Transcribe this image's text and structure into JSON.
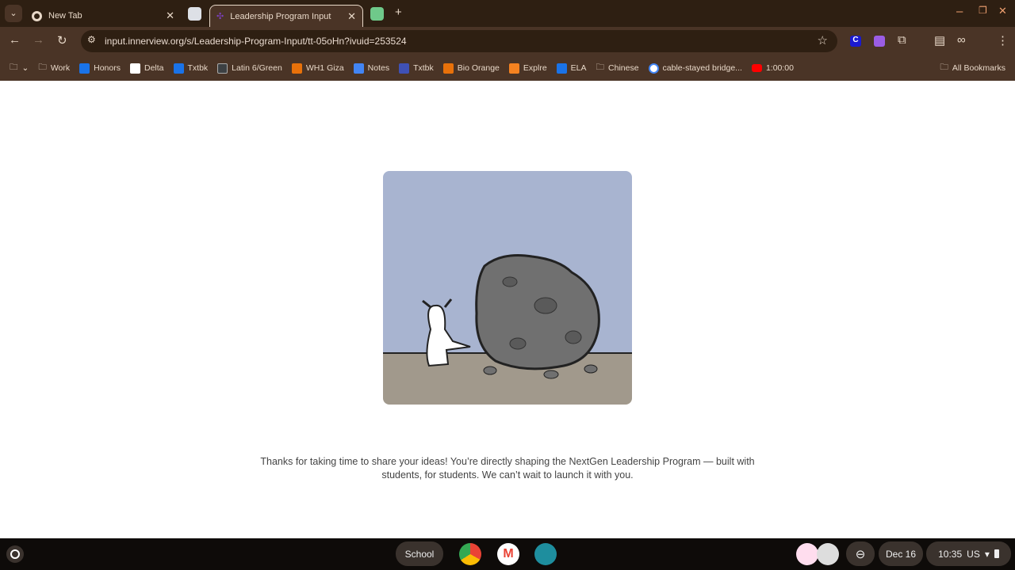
{
  "tabs": [
    {
      "label": "New Tab"
    },
    {
      "label": "Leadership Program Input",
      "active": true
    }
  ],
  "address": {
    "url": "input.innerview.org/s/Leadership-Program-Input/tt-05oHn?ivuid=253524"
  },
  "bookmarks": [
    {
      "label": "Work",
      "icon": "folder-icon"
    },
    {
      "label": "Honors",
      "color": "#1a73e8"
    },
    {
      "label": "Delta",
      "color": "#ffffff"
    },
    {
      "label": "Txtbk",
      "color": "#1a73e8"
    },
    {
      "label": "Latin 6/Green",
      "color": "#3c4043"
    },
    {
      "label": "WH1 Giza",
      "color": "#e8710a"
    },
    {
      "label": "Notes",
      "color": "#4285f4"
    },
    {
      "label": "Txtbk",
      "color": "#3f51b5"
    },
    {
      "label": "Bio Orange",
      "color": "#e8710a"
    },
    {
      "label": "Explre",
      "color": "#f58220"
    },
    {
      "label": "ELA",
      "color": "#1a73e8"
    },
    {
      "label": "Chinese",
      "icon": "folder-icon"
    },
    {
      "label": "cable-stayed bridge...",
      "icon": "google-icon"
    },
    {
      "label": "1:00:00",
      "color": "#ff0000"
    }
  ],
  "all_bookmarks": "All Bookmarks",
  "message": {
    "line1": "Thanks for taking  time to share your ideas! You’re directly shaping the NextGen Leadership Program — built with",
    "line2": "students, for students. We can’t wait to launch it with you."
  },
  "shelf": {
    "desk": "School",
    "date": "Dec 16",
    "time": "10:35",
    "locale": "US"
  }
}
